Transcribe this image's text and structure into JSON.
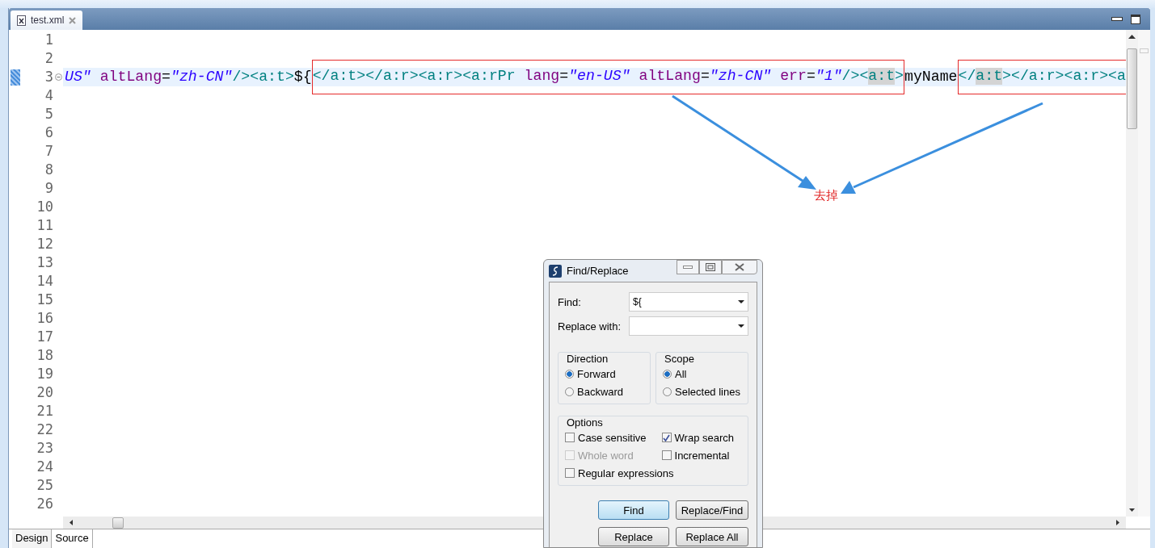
{
  "editor_tabs": [
    {
      "label": "test.xml",
      "selected": true
    }
  ],
  "lines": [
    {
      "number": "1",
      "current": false
    },
    {
      "number": "2",
      "current": false
    },
    {
      "number": "3",
      "current": true,
      "foldable": true,
      "groups": [
        {
          "boxed": false,
          "segments": [
            {
              "kind": "value",
              "text": "US\""
            },
            {
              "kind": "attr",
              "text": " altLang"
            },
            {
              "kind": "eq",
              "text": "="
            },
            {
              "kind": "value",
              "text": "\"zh-CN\""
            },
            {
              "kind": "tag",
              "text": "/><a:t>"
            },
            {
              "kind": "text",
              "text": "${"
            }
          ]
        },
        {
          "boxed": true,
          "segments": [
            {
              "kind": "tag",
              "text": "</a:t></a:r><a:r><a:rPr"
            },
            {
              "kind": "attr",
              "text": " lang"
            },
            {
              "kind": "eq",
              "text": "="
            },
            {
              "kind": "value",
              "text": "\"en-US\""
            },
            {
              "kind": "attr",
              "text": " altLang"
            },
            {
              "kind": "eq",
              "text": "="
            },
            {
              "kind": "value",
              "text": "\"zh-CN\""
            },
            {
              "kind": "attr",
              "text": " err"
            },
            {
              "kind": "eq",
              "text": "="
            },
            {
              "kind": "value",
              "text": "\"1\""
            },
            {
              "kind": "tag",
              "text": "/><"
            },
            {
              "kind": "match",
              "text": "a:t"
            },
            {
              "kind": "tag",
              "text": ">"
            }
          ]
        },
        {
          "boxed": false,
          "segments": [
            {
              "kind": "text",
              "text": "myName"
            }
          ]
        },
        {
          "boxed": true,
          "segments": [
            {
              "kind": "tag",
              "text": "</"
            },
            {
              "kind": "match",
              "text": "a:t"
            },
            {
              "kind": "tag",
              "text": "></a:r><a:r><a"
            }
          ]
        }
      ]
    },
    {
      "number": "4",
      "current": false
    },
    {
      "number": "5",
      "current": false
    },
    {
      "number": "6",
      "current": false
    },
    {
      "number": "7",
      "current": false
    },
    {
      "number": "8",
      "current": false
    },
    {
      "number": "9",
      "current": false
    },
    {
      "number": "10",
      "current": false
    },
    {
      "number": "11",
      "current": false
    },
    {
      "number": "12",
      "current": false
    },
    {
      "number": "13",
      "current": false
    },
    {
      "number": "14",
      "current": false
    },
    {
      "number": "15",
      "current": false
    },
    {
      "number": "16",
      "current": false
    },
    {
      "number": "17",
      "current": false
    },
    {
      "number": "18",
      "current": false
    },
    {
      "number": "19",
      "current": false
    },
    {
      "number": "20",
      "current": false
    },
    {
      "number": "21",
      "current": false
    },
    {
      "number": "22",
      "current": false
    },
    {
      "number": "23",
      "current": false
    },
    {
      "number": "24",
      "current": false
    },
    {
      "number": "25",
      "current": false
    },
    {
      "number": "26",
      "current": false
    }
  ],
  "annotation": {
    "text": "去掉"
  },
  "bottom_tabs": [
    {
      "label": "Design",
      "selected": false
    },
    {
      "label": "Source",
      "selected": true
    }
  ],
  "dialog": {
    "title": "Find/Replace",
    "fields": [
      {
        "label": "Find:",
        "value": "${"
      },
      {
        "label": "Replace with:"
      }
    ],
    "groups": [
      {
        "title": "Direction",
        "options": [
          {
            "label": "Forward",
            "selected": true
          },
          {
            "label": "Backward",
            "selected": false
          }
        ]
      },
      {
        "title": "Scope",
        "options": [
          {
            "label": "All",
            "selected": true
          },
          {
            "label": "Selected lines",
            "selected": false
          }
        ]
      }
    ],
    "options": {
      "title": "Options",
      "checkboxes": [
        {
          "label": "Case sensitive",
          "checked": false,
          "disabled": false
        },
        {
          "label": "Wrap search",
          "checked": true,
          "disabled": false
        },
        {
          "label": "Whole word",
          "checked": false,
          "disabled": true
        },
        {
          "label": "Incremental",
          "checked": false,
          "disabled": false
        },
        {
          "label": "Regular expressions",
          "checked": false,
          "disabled": false
        }
      ]
    },
    "buttons": [
      {
        "label": "Find",
        "default": true
      },
      {
        "label": "Replace/Find",
        "default": false
      },
      {
        "label": "Replace",
        "default": false
      },
      {
        "label": "Replace All",
        "default": false
      }
    ]
  }
}
